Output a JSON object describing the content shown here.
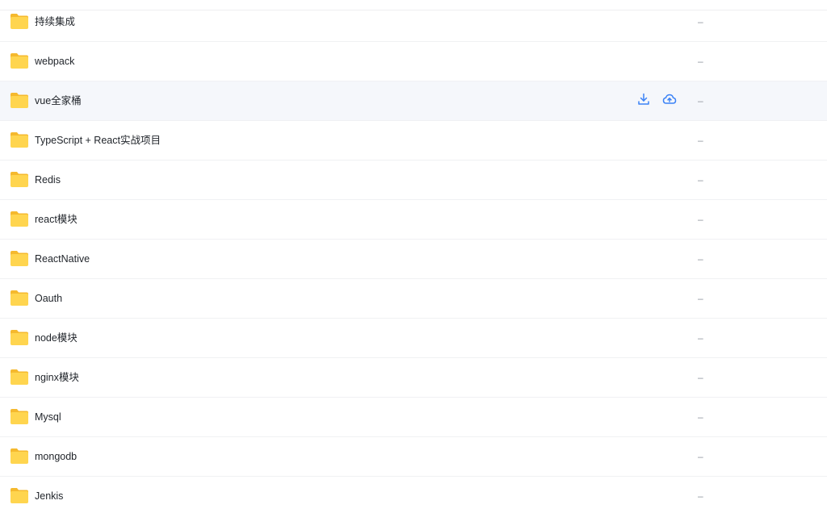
{
  "header": {
    "name_column": "",
    "size_column": ""
  },
  "files": [
    {
      "name": "持续集成",
      "size": "–",
      "icon": "folder-icon"
    },
    {
      "name": "webpack",
      "size": "–",
      "icon": "folder-icon"
    },
    {
      "name": "vue全家桶",
      "size": "–",
      "icon": "folder-icon",
      "hovered": true,
      "actions": [
        "download-icon",
        "cloud-upload-icon"
      ]
    },
    {
      "name": "TypeScript + React实战项目",
      "size": "–",
      "icon": "folder-icon"
    },
    {
      "name": "Redis",
      "size": "–",
      "icon": "folder-icon"
    },
    {
      "name": "react模块",
      "size": "–",
      "icon": "folder-icon"
    },
    {
      "name": "ReactNative",
      "size": "–",
      "icon": "folder-icon"
    },
    {
      "name": "Oauth",
      "size": "–",
      "icon": "folder-icon"
    },
    {
      "name": "node模块",
      "size": "–",
      "icon": "folder-icon"
    },
    {
      "name": "nginx模块",
      "size": "–",
      "icon": "folder-icon"
    },
    {
      "name": "Mysql",
      "size": "–",
      "icon": "folder-icon"
    },
    {
      "name": "mongodb",
      "size": "–",
      "icon": "folder-icon"
    },
    {
      "name": "Jenkis",
      "size": "–",
      "icon": "folder-icon"
    }
  ],
  "colors": {
    "folder_body": "#ffd54f",
    "folder_tab": "#f5b92e",
    "action_blue": "#3b82f6",
    "hover_row": "#f5f7fb"
  }
}
